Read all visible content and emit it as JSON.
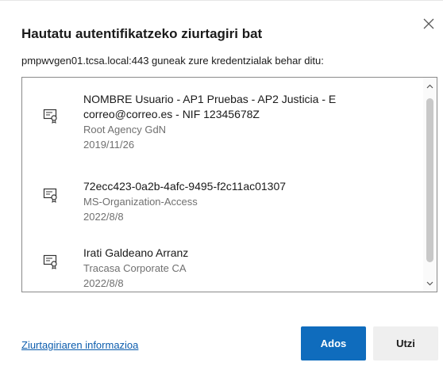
{
  "dialog": {
    "title": "Hautatu autentifikatzeko ziurtagiri bat",
    "subtitle": "pmpwvgen01.tcsa.local:443 guneak zure kredentzialak behar ditu:",
    "close_icon": "close-icon"
  },
  "certificates": [
    {
      "icon": "certificate-icon",
      "name_line1": "NOMBRE Usuario - AP1 Pruebas - AP2 Justicia - E",
      "name_line2": "correo@correo.es - NIF 12345678Z",
      "issuer": "Root Agency GdN",
      "date": "2019/11/26"
    },
    {
      "icon": "certificate-icon",
      "name_line1": "72ecc423-0a2b-4afc-9495-f2c11ac01307",
      "issuer": "MS-Organization-Access",
      "date": "2022/8/8"
    },
    {
      "icon": "certificate-icon",
      "name_line1": "Irati Galdeano Arranz",
      "issuer": "Tracasa Corporate CA",
      "date": "2022/8/8"
    }
  ],
  "footer": {
    "info_link": "Ziurtagiriaren informazioa",
    "ok_label": "Ados",
    "cancel_label": "Utzi"
  },
  "colors": {
    "primary": "#0f6cbd",
    "link": "#0b5cad"
  }
}
